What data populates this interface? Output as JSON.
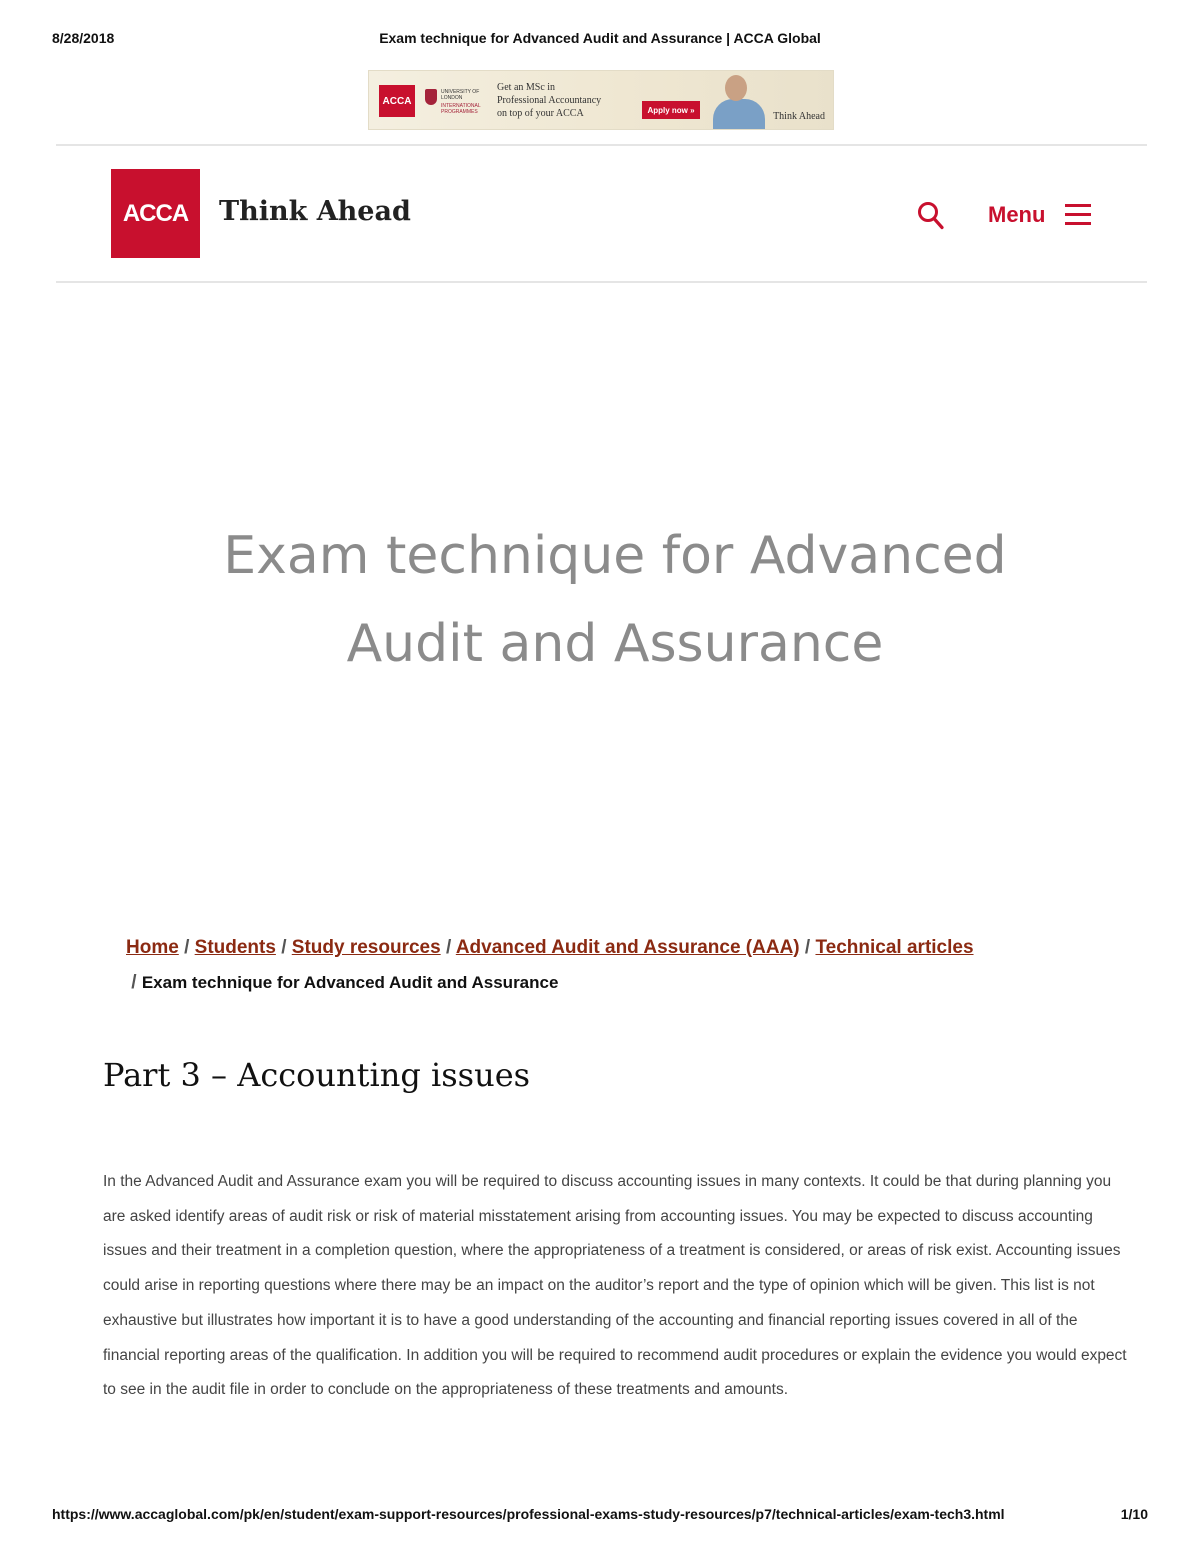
{
  "print_header": {
    "date": "8/28/2018",
    "title": "Exam technique for Advanced Audit and Assurance | ACCA Global"
  },
  "banner": {
    "acca_logo": "ACCA",
    "university_line1": "UNIVERSITY OF LONDON",
    "university_line2": "INTERNATIONAL PROGRAMMES",
    "text_line1": "Get an MSc in",
    "text_line2": "Professional Accountancy",
    "text_line3": "on top of your ACCA",
    "apply_button": "Apply now »",
    "tagline": "Think Ahead"
  },
  "site_header": {
    "logo_text": "ACCA",
    "tagline": "Think Ahead",
    "search_icon": "search-icon",
    "menu_label": "Menu",
    "menu_icon": "hamburger-icon",
    "accent_color": "#c8102e"
  },
  "hero": {
    "title": "Exam technique for Advanced Audit and Assurance"
  },
  "breadcrumb": {
    "items": [
      "Home",
      "Students",
      "Study resources",
      "Advanced Audit and Assurance (AAA)",
      "Technical articles"
    ],
    "separator": "/",
    "current": "Exam technique for Advanced Audit and Assurance"
  },
  "article": {
    "heading": "Part 3 – Accounting issues",
    "paragraph": "In the Advanced Audit and Assurance exam you will be required to discuss accounting issues in many contexts. It could be that during planning you are asked identify areas of audit risk or risk of material misstatement arising from accounting issues.  You may be expected to discuss accounting issues and their treatment in a completion question, where the appropriateness of a treatment is considered, or areas of risk exist. Accounting issues could arise in reporting questions where there may be an impact on the auditor’s report and the type of opinion which will be given. This list is not exhaustive but illustrates how important it is to have a good understanding of the accounting and financial reporting issues covered in all of the financial reporting areas of the qualification. In addition you will be required to recommend audit procedures or explain the evidence you would expect to see in the audit file in order to conclude on the appropriateness of these treatments and amounts."
  },
  "print_footer": {
    "url": "https://www.accaglobal.com/pk/en/student/exam-support-resources/professional-exams-study-resources/p7/technical-articles/exam-tech3.html",
    "page": "1/10"
  }
}
